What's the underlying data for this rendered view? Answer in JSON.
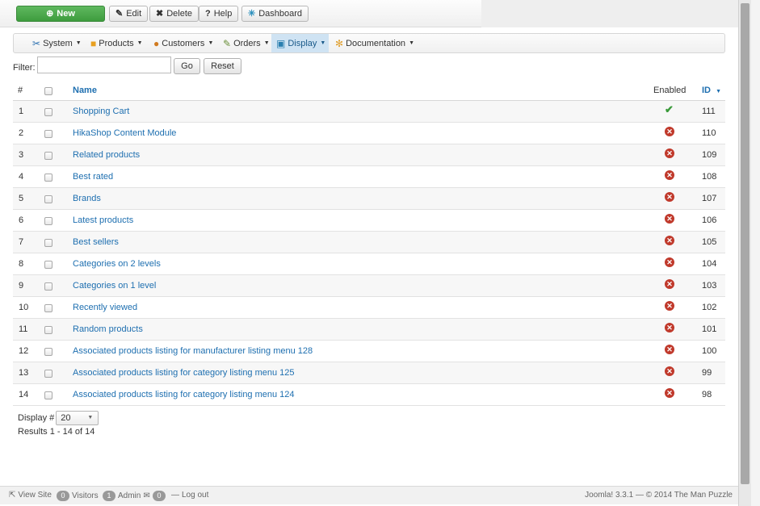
{
  "toolbar": {
    "new_label": "New",
    "edit_label": "Edit",
    "delete_label": "Delete",
    "help_label": "Help",
    "dashboard_label": "Dashboard"
  },
  "menu": {
    "items": [
      {
        "label": "System",
        "icon": "tools-icon"
      },
      {
        "label": "Products",
        "icon": "box-icon"
      },
      {
        "label": "Customers",
        "icon": "users-icon"
      },
      {
        "label": "Orders",
        "icon": "orders-icon"
      },
      {
        "label": "Display",
        "icon": "display-icon",
        "active": true
      },
      {
        "label": "Documentation",
        "icon": "documentation-icon"
      }
    ]
  },
  "filter": {
    "label": "Filter:",
    "value": "",
    "go_label": "Go",
    "reset_label": "Reset"
  },
  "table": {
    "headers": {
      "num": "#",
      "name": "Name",
      "enabled": "Enabled",
      "id": "ID"
    },
    "sort_indicator": "▼",
    "rows": [
      {
        "num": "1",
        "name": "Shopping Cart",
        "enabled": true,
        "id": "111"
      },
      {
        "num": "2",
        "name": "HikaShop Content Module",
        "enabled": false,
        "id": "110"
      },
      {
        "num": "3",
        "name": "Related products",
        "enabled": false,
        "id": "109"
      },
      {
        "num": "4",
        "name": "Best rated",
        "enabled": false,
        "id": "108"
      },
      {
        "num": "5",
        "name": "Brands",
        "enabled": false,
        "id": "107"
      },
      {
        "num": "6",
        "name": "Latest products",
        "enabled": false,
        "id": "106"
      },
      {
        "num": "7",
        "name": "Best sellers",
        "enabled": false,
        "id": "105"
      },
      {
        "num": "8",
        "name": "Categories on 2 levels",
        "enabled": false,
        "id": "104"
      },
      {
        "num": "9",
        "name": "Categories on 1 level",
        "enabled": false,
        "id": "103"
      },
      {
        "num": "10",
        "name": "Recently viewed",
        "enabled": false,
        "id": "102"
      },
      {
        "num": "11",
        "name": "Random products",
        "enabled": false,
        "id": "101"
      },
      {
        "num": "12",
        "name": "Associated products listing for manufacturer listing menu 128",
        "enabled": false,
        "id": "100"
      },
      {
        "num": "13",
        "name": "Associated products listing for category listing menu 125",
        "enabled": false,
        "id": "99"
      },
      {
        "num": "14",
        "name": "Associated products listing for category listing menu 124",
        "enabled": false,
        "id": "98"
      }
    ]
  },
  "pagination": {
    "display_label": "Display #",
    "display_value": "20",
    "results": "Results 1 - 14 of 14"
  },
  "footer": {
    "view_site": "View Site",
    "visitors_count": "0",
    "visitors_label": "Visitors",
    "admin_count": "1",
    "admin_label": "Admin",
    "messages_count": "0",
    "logout": "Log out",
    "copyright": "Joomla! 3.3.1 — © 2014 The Man Puzzle"
  },
  "colors": {
    "link": "#1e6fb0",
    "new_button": "#4cab4c",
    "disabled_icon": "#c0392b",
    "enabled_icon": "#3a9a3a",
    "active_menu": "#cfe3f3"
  }
}
